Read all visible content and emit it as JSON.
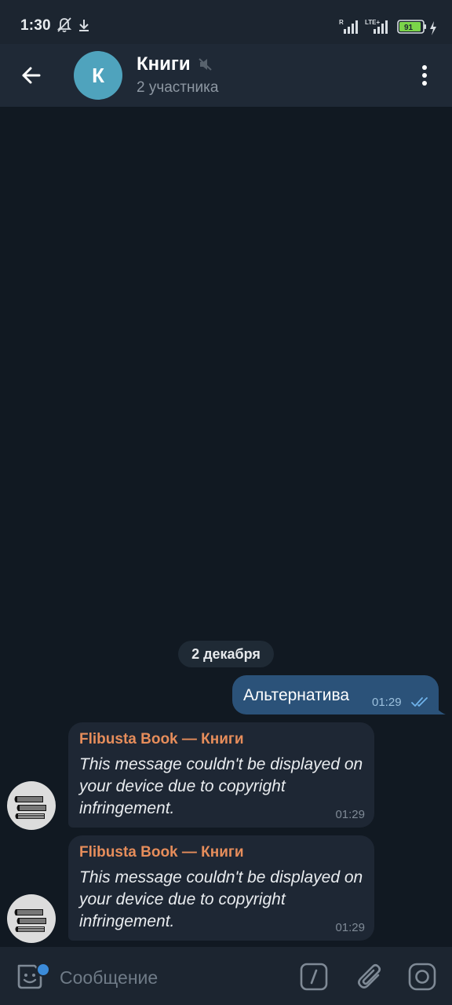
{
  "status_bar": {
    "time": "1:30",
    "battery": "91",
    "icons": [
      "bell-off-icon",
      "download-icon",
      "signal-r-icon",
      "lte-signal-icon",
      "battery-icon",
      "charging-icon"
    ]
  },
  "header": {
    "back_icon": "arrow-left-icon",
    "avatar_letter": "К",
    "title": "Книги",
    "subtitle": "2 участника",
    "muted": true,
    "menu_icon": "more-vertical-icon"
  },
  "chat": {
    "date_divider": "2 декабря",
    "messages": [
      {
        "direction": "outgoing",
        "text": "Альтернатива",
        "time": "01:29",
        "status": "read"
      },
      {
        "direction": "incoming",
        "author": "Flibusta Book — Книги",
        "text": "This message couldn't be displayed on your device due to copyright infringement.",
        "time": "01:29",
        "avatar_icon": "books-icon"
      },
      {
        "direction": "incoming",
        "author": "Flibusta Book — Книги",
        "text": "This message couldn't be displayed on your device due to copyright infringement.",
        "time": "01:29",
        "avatar_icon": "books-icon"
      }
    ]
  },
  "composer": {
    "placeholder": "Сообщение",
    "icons": [
      "sticker-icon",
      "bot-command-icon",
      "paperclip-icon",
      "camera-icon"
    ]
  },
  "colors": {
    "header_bg": "#1f2936",
    "chat_bg": "#111922",
    "outgoing_bubble": "#2b5279",
    "incoming_bubble": "#1e2734",
    "author_name": "#e68d5b",
    "avatar_bg": "#4fa3bd",
    "unread_dot": "#3b8bd9"
  }
}
